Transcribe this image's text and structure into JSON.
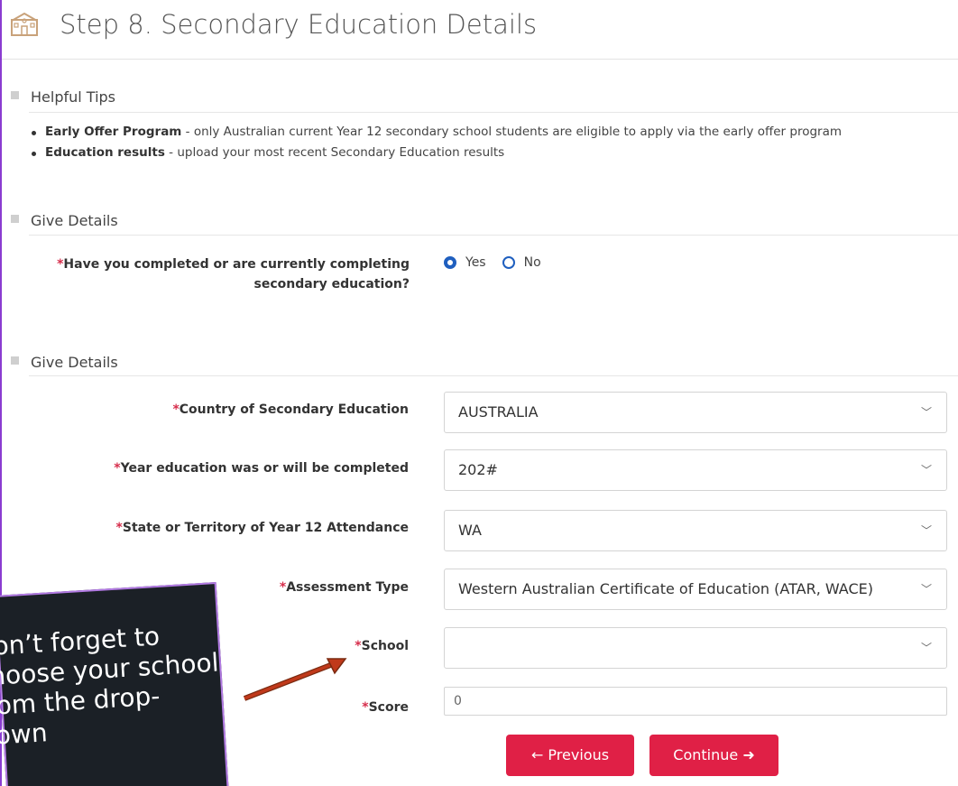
{
  "header": {
    "title": "Step 8. Secondary Education Details",
    "icon": "school-icon"
  },
  "tips": {
    "heading": "Helpful Tips",
    "items": [
      {
        "bold": "Early Offer Program",
        "text": " - only Australian current Year 12 secondary school students are eligible to apply via the early offer program"
      },
      {
        "bold": "Education results",
        "text": " - upload your most recent Secondary Education results"
      }
    ]
  },
  "section1": {
    "heading": "Give Details",
    "question_line1": "Have you completed or are currently completing",
    "question_line2": "secondary education?",
    "options": [
      {
        "label": "Yes",
        "checked": true
      },
      {
        "label": "No",
        "checked": false
      }
    ]
  },
  "section2": {
    "heading": "Give Details",
    "fields": {
      "country": {
        "label": "Country of Secondary Education",
        "value": "AUSTRALIA"
      },
      "year": {
        "label": "Year education was or will be completed",
        "value": "202#"
      },
      "state": {
        "label": "State or Territory of Year 12 Attendance",
        "value": "WA"
      },
      "assessment": {
        "label": "Assessment Type",
        "value": "Western Australian Certificate of Education (ATAR, WACE)"
      },
      "school": {
        "label": "School",
        "value": ""
      },
      "score": {
        "label": "Score",
        "value": "0"
      }
    },
    "required_marker": "*"
  },
  "buttons": {
    "previous": "← Previous",
    "continue": "Continue ➜"
  },
  "callout": {
    "text": "Don’t forget to choose your school from the drop-down"
  },
  "colors": {
    "accent": "#e02046",
    "radio": "#1f5fbf",
    "background": "#7a2bc4",
    "callout": "#1b2026",
    "arrow": "#c0391b"
  }
}
